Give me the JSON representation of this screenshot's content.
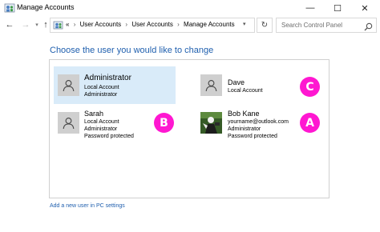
{
  "window": {
    "title": "Manage Accounts",
    "minimize_glyph": "—",
    "maximize_glyph": "☐",
    "close_glyph": "✕"
  },
  "nav": {
    "back_glyph": "←",
    "forward_glyph": "→",
    "dropdown_glyph": "▾",
    "up_glyph": "↑",
    "prefix": "«",
    "breadcrumbs": [
      "User Accounts",
      "User Accounts",
      "Manage Accounts"
    ],
    "separator": "›",
    "refresh_glyph": "↻",
    "search_placeholder": "Search Control Panel"
  },
  "main": {
    "heading": "Choose the user you would like to change",
    "users": [
      {
        "name": "Administrator",
        "lines": [
          "Local Account",
          "Administrator"
        ],
        "selected": true,
        "avatar": "default-avatar-icon"
      },
      {
        "name": "Dave",
        "lines": [
          "Local Account"
        ],
        "badge": "C",
        "avatar": "default-avatar-icon"
      },
      {
        "name": "Sarah",
        "lines": [
          "Local Account",
          "Administrator",
          "Password protected"
        ],
        "badge": "B",
        "avatar": "default-avatar-icon"
      },
      {
        "name": "Bob Kane",
        "lines": [
          "yourname@outlook.com",
          "Administrator",
          "Password protected"
        ],
        "badge": "A",
        "avatar": "photo"
      }
    ],
    "add_user_link": "Add a new user in PC settings"
  },
  "colors": {
    "accent": "#1f5fae",
    "badge": "#ff17d1",
    "selected_bg": "#d9ebf9",
    "avatar_bg": "#cfcfcf"
  }
}
